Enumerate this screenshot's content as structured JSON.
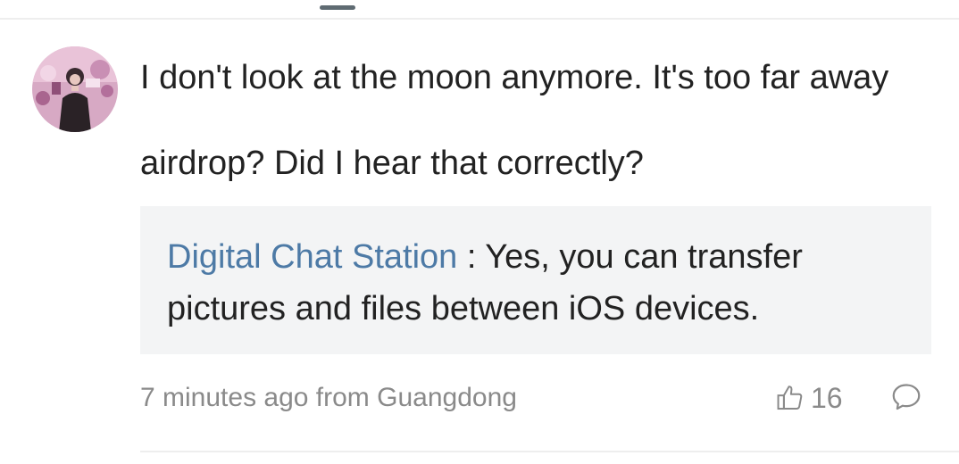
{
  "comment": {
    "line1": "I don't look at the moon anymore. It's too far away",
    "line2": "airdrop? Did I hear that correctly?"
  },
  "reply": {
    "author": "Digital Chat Station",
    "separator": " : ",
    "text": "Yes, you can transfer pictures and files between iOS devices."
  },
  "meta": {
    "time_location": "7 minutes ago from Guangdong"
  },
  "actions": {
    "like_count": "16",
    "like_icon": "thumbs-up-icon",
    "reply_icon": "speech-bubble-icon"
  },
  "colors": {
    "link": "#4d7aa6",
    "text": "#222222",
    "muted": "#8a8a8a",
    "reply_bg": "#f3f4f5"
  }
}
